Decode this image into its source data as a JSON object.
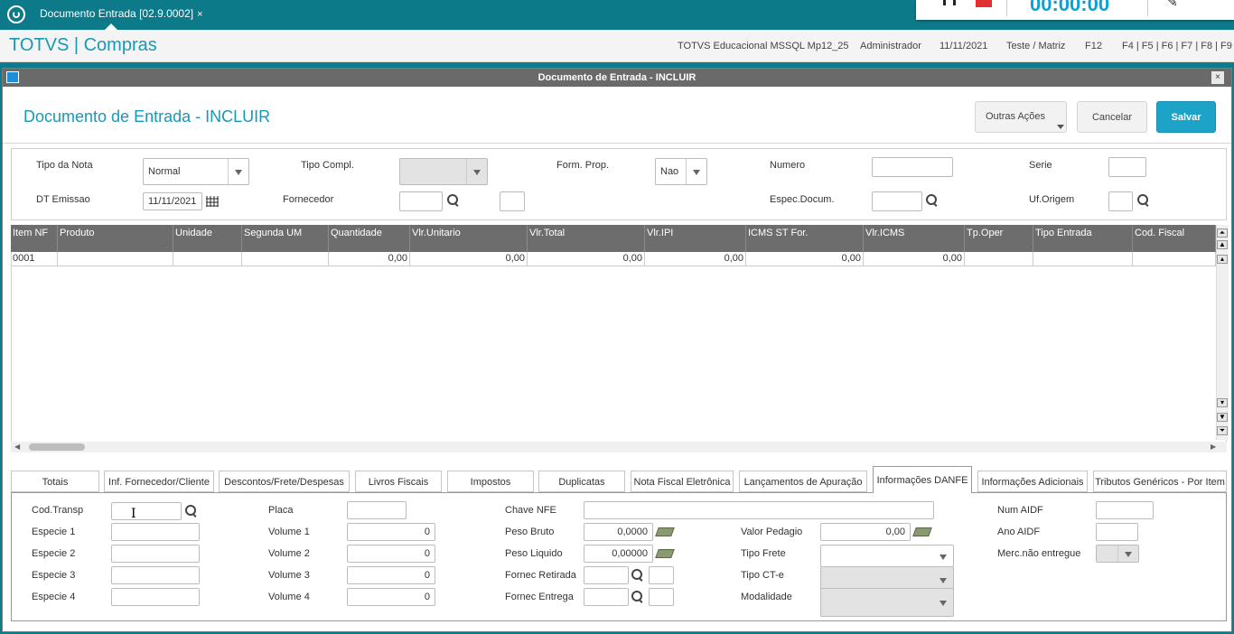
{
  "tab_bar": {
    "doc_tab_label": "Documento Entrada [02.9.0002]",
    "close_glyph": "×"
  },
  "recorder": {
    "time": "00:00:00"
  },
  "header": {
    "brand": "TOTVS | Compras",
    "environment": "TOTVS Educacional MSSQL Mp12_25",
    "user": "Administrador",
    "date": "11/11/2021",
    "company": "Teste / Matriz",
    "help_key": "F12",
    "shortcut_keys": "F4 | F5 | F6 | F7 | F8 | F9"
  },
  "window": {
    "title": "Documento de Entrada - INCLUIR",
    "close_glyph": "×"
  },
  "page": {
    "title": "Documento de Entrada - INCLUIR"
  },
  "actions": {
    "more": "Outras Ações",
    "cancel": "Cancelar",
    "save": "Salvar"
  },
  "form": {
    "tipo_nota": {
      "label": "Tipo da Nota",
      "value": "Normal"
    },
    "tipo_compl": {
      "label": "Tipo Compl.",
      "value": ""
    },
    "form_prop": {
      "label": "Form. Prop.",
      "value": "Nao"
    },
    "numero": {
      "label": "Numero",
      "value": ""
    },
    "serie": {
      "label": "Serie",
      "value": ""
    },
    "dt_emissao": {
      "label": "DT Emissao",
      "value": "11/11/2021"
    },
    "fornecedor": {
      "label": "Fornecedor",
      "value": ""
    },
    "espec_docum": {
      "label": "Espec.Docum.",
      "value": ""
    },
    "uf_origem": {
      "label": "Uf.Origem",
      "value": ""
    }
  },
  "grid": {
    "columns": [
      "Item NF",
      "Produto",
      "Unidade",
      "Segunda UM",
      "Quantidade",
      "Vlr.Unitario",
      "Vlr.Total",
      "Vlr.IPI",
      "ICMS ST For.",
      "Vlr.ICMS",
      "Tp.Oper",
      "Tipo Entrada",
      "Cod. Fiscal"
    ],
    "rows": [
      [
        "0001",
        "",
        "",
        "",
        "0,00",
        "0,00",
        "0,00",
        "0,00",
        "0,00",
        "0,00",
        "",
        "",
        ""
      ]
    ]
  },
  "tabs": [
    "Totais",
    "Inf. Fornecedor/Cliente",
    "Descontos/Frete/Despesas",
    "Livros Fiscais",
    "Impostos",
    "Duplicatas",
    "Nota Fiscal Eletrônica",
    "Lançamentos de Apuração",
    "Informações DANFE",
    "Informações Adicionais",
    "Tributos Genéricos - Por Item"
  ],
  "active_tab": "Informações DANFE",
  "danfe": {
    "cod_transp": {
      "label": "Cod.Transp",
      "value": ""
    },
    "especie1": {
      "label": "Especie 1",
      "value": ""
    },
    "especie2": {
      "label": "Especie 2",
      "value": ""
    },
    "especie3": {
      "label": "Especie 3",
      "value": ""
    },
    "especie4": {
      "label": "Especie 4",
      "value": ""
    },
    "placa": {
      "label": "Placa",
      "value": ""
    },
    "volume1": {
      "label": "Volume 1",
      "value": "0"
    },
    "volume2": {
      "label": "Volume 2",
      "value": "0"
    },
    "volume3": {
      "label": "Volume 3",
      "value": "0"
    },
    "volume4": {
      "label": "Volume 4",
      "value": "0"
    },
    "chave_nfe": {
      "label": "Chave NFE",
      "value": ""
    },
    "peso_bruto": {
      "label": "Peso Bruto",
      "value": "0,0000"
    },
    "peso_liquido": {
      "label": "Peso Liquido",
      "value": "0,00000"
    },
    "fornec_retirada": {
      "label": "Fornec Retirada",
      "value": ""
    },
    "fornec_entrega": {
      "label": "Fornec Entrega",
      "value": ""
    },
    "valor_pedagio": {
      "label": "Valor Pedagio",
      "value": "0,00"
    },
    "tipo_frete": {
      "label": "Tipo Frete",
      "value": ""
    },
    "tipo_cte": {
      "label": "Tipo CT-e",
      "value": ""
    },
    "modalidade": {
      "label": "Modalidade",
      "value": ""
    },
    "num_aidf": {
      "label": "Num AIDF",
      "value": ""
    },
    "ano_aidf": {
      "label": "Ano AIDF",
      "value": ""
    },
    "merc_nao_entregue": {
      "label": "Merc.não entregue",
      "value": ""
    }
  },
  "colors": {
    "brand": "#1998b5",
    "topbar": "#0d7a8a",
    "grid_header": "#6d6d6d",
    "save": "#1ea3c8"
  }
}
